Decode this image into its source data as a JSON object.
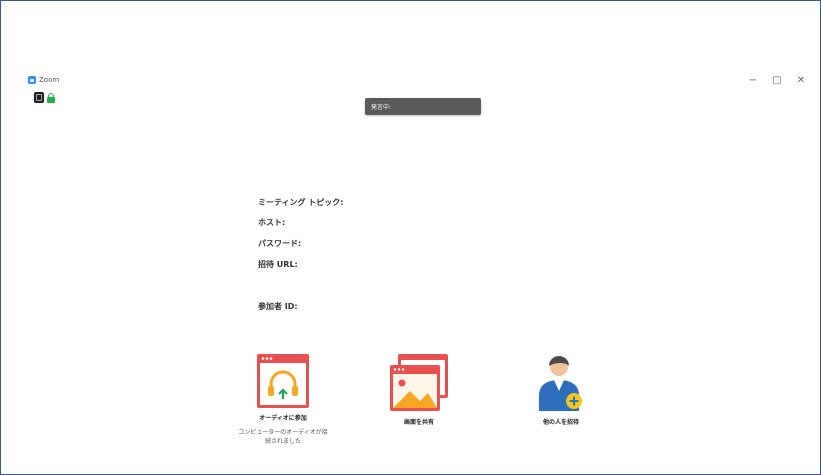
{
  "window": {
    "app_name": "Zoom",
    "controls": [
      "−",
      "▢",
      "✕"
    ]
  },
  "speaking": "発言中:",
  "meeting_info": {
    "topic_label": "ミーティング トピック:",
    "host_label": "ホスト:",
    "password_label": "パスワード:",
    "invite_url_label": "招待 URL:",
    "participant_id_label": "参加者 ID:"
  },
  "actions": {
    "join_audio": {
      "label": "オーディオに参加",
      "subtext_line1": "コンピューターのオーディオが接",
      "subtext_line2": "続されました"
    },
    "share_screen": {
      "label": "画面を共有"
    },
    "invite": {
      "label": "他の人を招待"
    }
  },
  "colors": {
    "brand": "#2d8cff",
    "accent_red": "#e8504f",
    "frame": "#2f5d9e"
  }
}
